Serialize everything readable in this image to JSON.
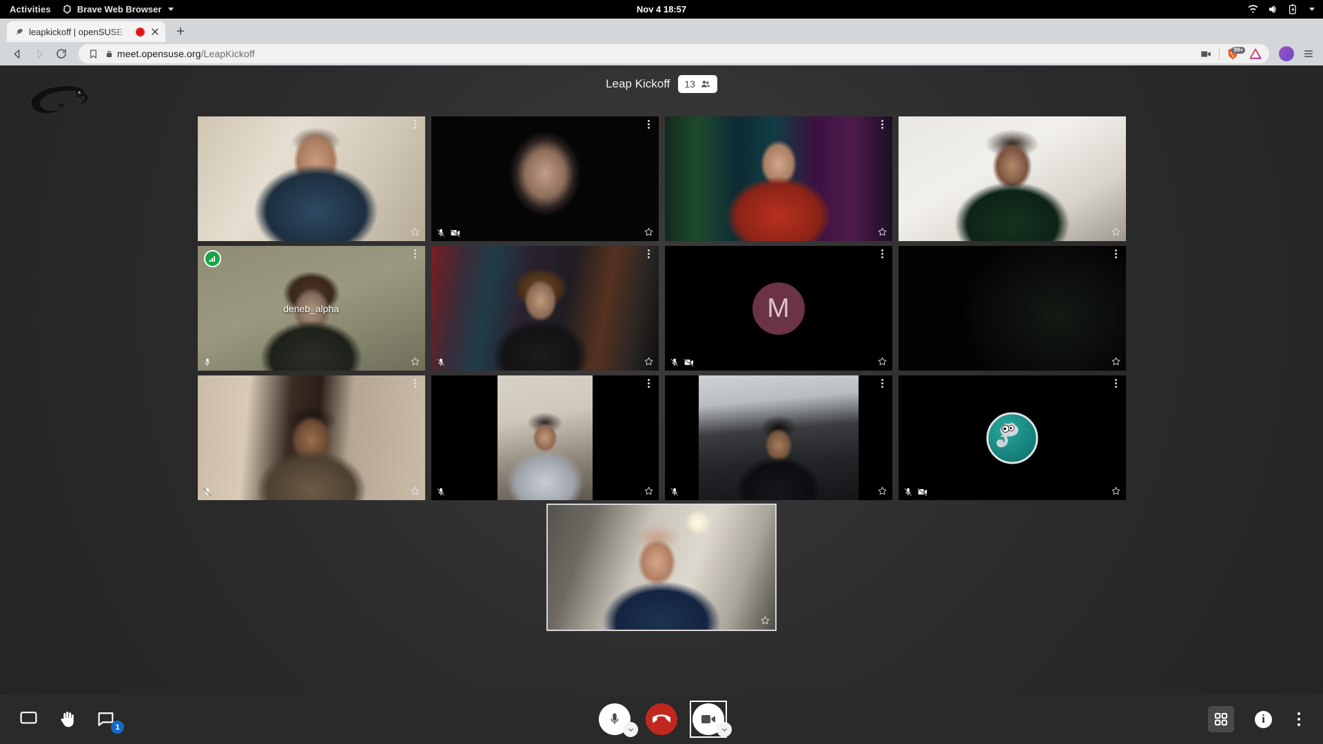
{
  "desktop": {
    "activities_label": "Activities",
    "app_name": "Brave Web Browser",
    "clock": "Nov 4  18:57",
    "tray": [
      "wifi-icon",
      "volume-icon",
      "battery-charging-icon",
      "system-menu-caret-icon"
    ]
  },
  "browser": {
    "tab_title": "leapkickoff | openSUSE",
    "tab_recording_indicator": "recording-dot",
    "new_tab_label": "+",
    "url_host": "meet.opensuse.org",
    "url_path": "/LeapKickoff",
    "shield_badge_count": "99+",
    "icons": {
      "back": "back-arrow-icon",
      "forward": "forward-arrow-icon",
      "reload": "reload-icon",
      "bookmark": "bookmark-icon",
      "lock": "lock-icon",
      "camera_permission": "camera-permission-icon",
      "shields": "brave-shields-icon",
      "rewards": "brave-rewards-icon",
      "profile": "profile-avatar",
      "menu": "hamburger-menu-icon"
    }
  },
  "meeting": {
    "logo": "opensuse-chameleon-logo",
    "title": "Leap Kickoff",
    "participant_count": "13",
    "participant_icon": "people-icon",
    "tiles": [
      {
        "id": "t1",
        "name": "",
        "kind": "video",
        "muted": false,
        "camera_off": false,
        "dominant": false,
        "scene": "man-headset-light-room",
        "letterbox": false
      },
      {
        "id": "t2",
        "name": "",
        "kind": "video",
        "muted": true,
        "camera_off": true,
        "dominant": false,
        "scene": "woman-glasses-dark",
        "letterbox": false
      },
      {
        "id": "t3",
        "name": "",
        "kind": "video",
        "muted": false,
        "camera_off": false,
        "dominant": false,
        "scene": "man-green-led-room",
        "letterbox": false
      },
      {
        "id": "t4",
        "name": "",
        "kind": "video",
        "muted": false,
        "camera_off": false,
        "dominant": false,
        "scene": "man-headset-white-wall",
        "letterbox": false
      },
      {
        "id": "t5",
        "name": "deneb_alpha",
        "kind": "video",
        "muted": true,
        "camera_off": false,
        "dominant": true,
        "scene": "person-olive-wall",
        "letterbox": false
      },
      {
        "id": "t6",
        "name": "",
        "kind": "video",
        "muted": true,
        "camera_off": false,
        "dominant": false,
        "scene": "man-poster-wall",
        "letterbox": false
      },
      {
        "id": "t7",
        "name": "",
        "kind": "avatar-letter",
        "letter": "M",
        "muted": true,
        "camera_off": true,
        "dominant": false,
        "avatar_color": "#6b3348"
      },
      {
        "id": "t8",
        "name": "",
        "kind": "video",
        "muted": false,
        "camera_off": false,
        "dominant": false,
        "scene": "dark-room",
        "letterbox": false
      },
      {
        "id": "t9",
        "name": "",
        "kind": "video",
        "muted": true,
        "camera_off": false,
        "dominant": false,
        "scene": "bearded-man-doorway",
        "letterbox": false
      },
      {
        "id": "t10",
        "name": "",
        "kind": "video",
        "muted": true,
        "camera_off": false,
        "dominant": false,
        "scene": "man-couch-portrait",
        "letterbox": true
      },
      {
        "id": "t11",
        "name": "",
        "kind": "video",
        "muted": true,
        "camera_off": false,
        "dominant": false,
        "scene": "man-bedroom",
        "letterbox": true
      },
      {
        "id": "t12",
        "name": "",
        "kind": "avatar-image",
        "muted": true,
        "camera_off": true,
        "dominant": false,
        "avatar": "geeko-chameleon-avatar"
      }
    ],
    "self_tile": {
      "id": "self",
      "name": "",
      "kind": "video",
      "scene": "bald-man-headset-kitchen",
      "focused": true
    }
  },
  "controls": {
    "left": [
      {
        "name": "share-screen-button",
        "icon": "monitor-icon",
        "label": ""
      },
      {
        "name": "raise-hand-button",
        "icon": "hand-icon",
        "label": ""
      },
      {
        "name": "chat-button",
        "icon": "chat-bubble-icon",
        "label": "",
        "badge": "1"
      }
    ],
    "center": {
      "mic": {
        "icon": "microphone-icon",
        "state": "on",
        "has_dropdown": true
      },
      "hangup": {
        "icon": "phone-hangup-icon",
        "color": "#c0281f"
      },
      "camera": {
        "icon": "video-camera-icon",
        "state": "on",
        "has_dropdown": true,
        "focused": true
      }
    },
    "right": [
      {
        "name": "tile-view-button",
        "icon": "grid-view-icon",
        "active": true
      },
      {
        "name": "meeting-info-button",
        "icon": "info-icon",
        "label": "i"
      },
      {
        "name": "more-options-button",
        "icon": "kebab-menu-icon"
      }
    ]
  }
}
